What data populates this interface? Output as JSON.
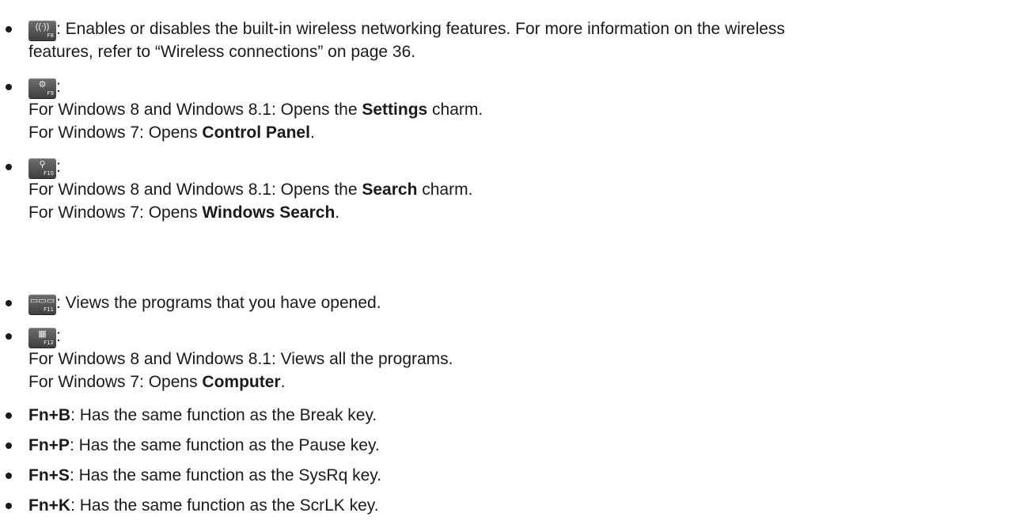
{
  "items": [
    {
      "key": {
        "icon": "wireless-antenna-icon",
        "glyph": "((ᐧ))",
        "label": "F8"
      },
      "text": ": Enables or disables the built-in wireless networking features. For more information on the wireless",
      "text2": "features, refer to “Wireless connections” on page 36."
    },
    {
      "key": {
        "icon": "gear-icon",
        "glyph": "⚙",
        "label": "F9"
      },
      "colon": ":",
      "win8_prefix": "For Windows 8 and Windows 8.1: Opens the ",
      "win8_bold": "Settings",
      "win8_suffix": " charm.",
      "win7_prefix": "For Windows 7: Opens ",
      "win7_bold": "Control Panel",
      "win7_suffix": "."
    },
    {
      "key": {
        "icon": "search-icon",
        "glyph": "⚲",
        "label": "F10"
      },
      "colon": ":",
      "win8_prefix": "For Windows 8 and Windows 8.1: Opens the ",
      "win8_bold": "Search",
      "win8_suffix": " charm.",
      "win7_prefix": "For Windows 7: Opens ",
      "win7_bold": "Windows Search",
      "win7_suffix": "."
    },
    {
      "key": {
        "icon": "task-switch-icon",
        "glyph": "▭▭▭",
        "label": "F11"
      },
      "text": ": Views the programs that you have opened."
    },
    {
      "key": {
        "icon": "all-programs-grid-icon",
        "glyph": "▦",
        "label": "F12"
      },
      "colon": ":",
      "win8_text": "For Windows 8 and Windows 8.1: Views all the programs.",
      "win7_prefix": "For Windows 7: Opens ",
      "win7_bold": "Computer",
      "win7_suffix": "."
    },
    {
      "combo": "Fn+B",
      "text": ": Has the same function as the Break key."
    },
    {
      "combo": "Fn+P",
      "text": ": Has the same function as the Pause key."
    },
    {
      "combo": "Fn+S",
      "text": ": Has the same function as the SysRq key."
    },
    {
      "combo": "Fn+K",
      "text": ": Has the same function as the ScrLK key."
    }
  ]
}
